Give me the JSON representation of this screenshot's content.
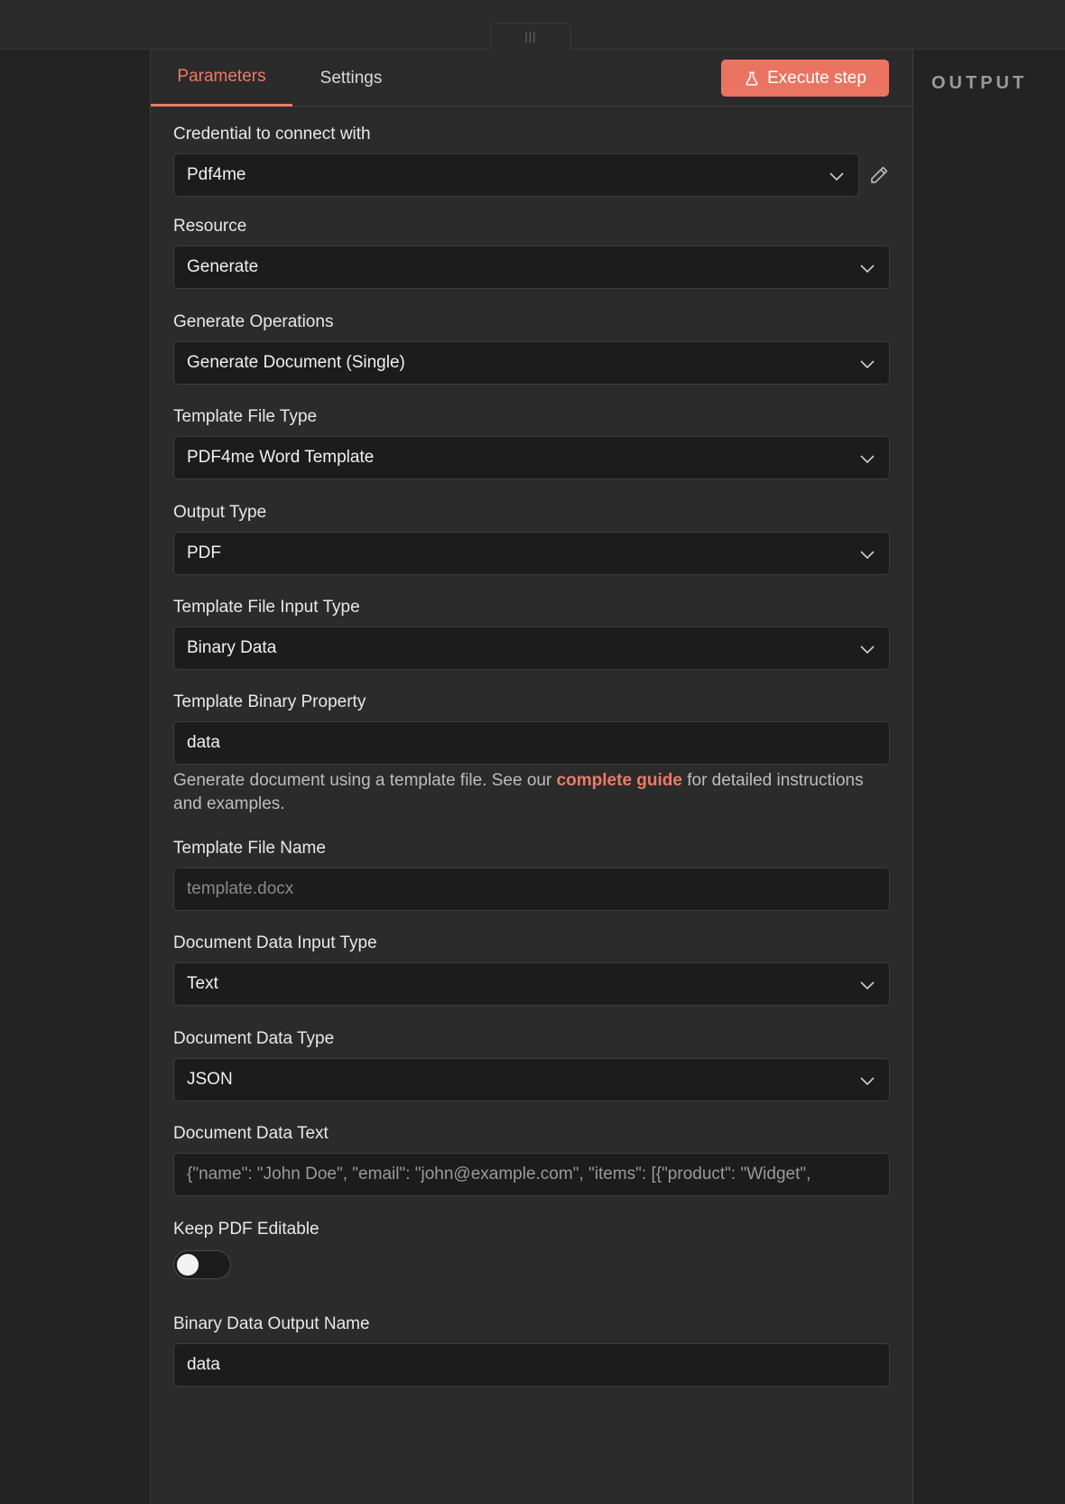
{
  "tabs": [
    {
      "label": "Parameters",
      "active": true
    },
    {
      "label": "Settings",
      "active": false
    }
  ],
  "execute_button": {
    "label": "Execute step",
    "icon": "flask-icon"
  },
  "output": {
    "title": "OUTPUT"
  },
  "fields": {
    "credential": {
      "label": "Credential to connect with",
      "value": "Pdf4me"
    },
    "resource": {
      "label": "Resource",
      "value": "Generate"
    },
    "operation": {
      "label": "Generate Operations",
      "value": "Generate Document (Single)"
    },
    "template_file_type": {
      "label": "Template File Type",
      "value": "PDF4me Word Template"
    },
    "output_type": {
      "label": "Output Type",
      "value": "PDF"
    },
    "template_input_type": {
      "label": "Template File Input Type",
      "value": "Binary Data"
    },
    "template_binary_property": {
      "label": "Template Binary Property",
      "value": "data"
    },
    "hint": {
      "before": "Generate document using a template file. See our ",
      "link": "complete guide",
      "after": " for detailed instructions and examples."
    },
    "template_file_name": {
      "label": "Template File Name",
      "placeholder": "template.docx"
    },
    "document_data_input_type": {
      "label": "Document Data Input Type",
      "value": "Text"
    },
    "document_data_type": {
      "label": "Document Data Type",
      "value": "JSON"
    },
    "document_data_text": {
      "label": "Document Data Text",
      "placeholder": "{\"name\": \"John Doe\", \"email\": \"john@example.com\", \"items\": [{\"product\": \"Widget\","
    },
    "keep_pdf_editable": {
      "label": "Keep PDF Editable",
      "enabled": false
    },
    "binary_output_name": {
      "label": "Binary Data Output Name",
      "value": "data"
    }
  },
  "colors": {
    "accent": "#ea7461",
    "background": "#2b2b2b",
    "input_bg": "#1c1c1c"
  }
}
